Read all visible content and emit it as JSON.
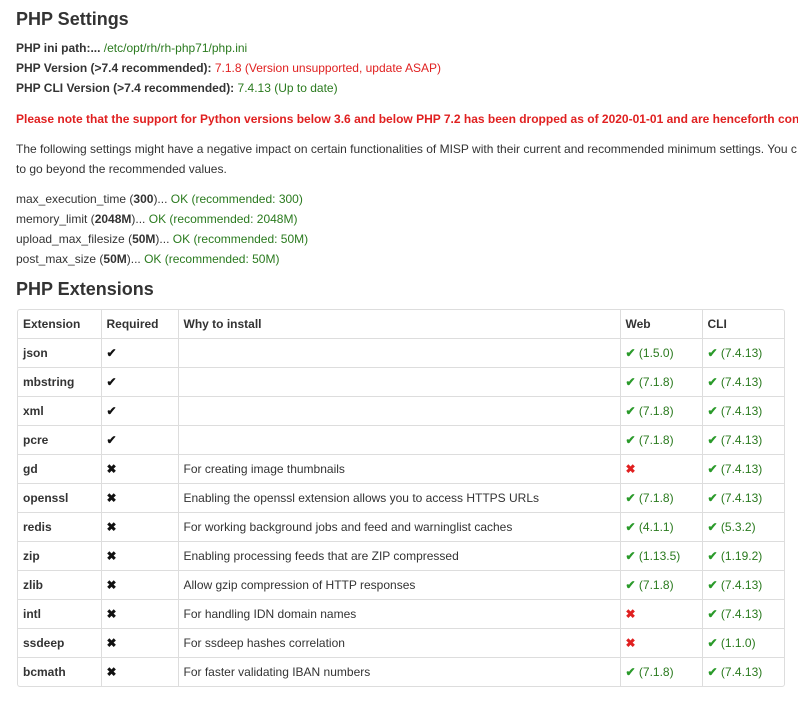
{
  "php_settings": {
    "title": "PHP Settings",
    "ini_label": "PHP ini path:...",
    "ini_value": "/etc/opt/rh/rh-php71/php.ini",
    "version_label": "PHP Version (>7.4 recommended):",
    "version_value": "7.1.8 (Version unsupported, update ASAP)",
    "cli_label": "PHP CLI Version (>7.4 recommended):",
    "cli_value": "7.4.13 (Up to date)",
    "warning": "Please note that the support for Python versions below 3.6 and below PHP 7.2 has been dropped as of 2020-01-01 and are henceforth con",
    "desc_line1": "The following settings might have a negative impact on certain functionalities of MISP with their current and recommended minimum settings. You c",
    "desc_line2": "to go beyond the recommended values.",
    "settings": [
      {
        "name": "max_execution_time",
        "value": "300",
        "status": "OK (recommended: 300)"
      },
      {
        "name": "memory_limit",
        "value": "2048M",
        "status": "OK (recommended: 2048M)"
      },
      {
        "name": "upload_max_filesize",
        "value": "50M",
        "status": "OK (recommended: 50M)"
      },
      {
        "name": "post_max_size",
        "value": "50M",
        "status": "OK (recommended: 50M)"
      }
    ]
  },
  "php_extensions": {
    "title": "PHP Extensions",
    "headers": [
      "Extension",
      "Required",
      "Why to install",
      "Web",
      "CLI"
    ],
    "rows": [
      {
        "name": "json",
        "required": "✔",
        "why": "",
        "web_ok": true,
        "web": "(1.5.0)",
        "cli_ok": true,
        "cli": "(7.4.13)"
      },
      {
        "name": "mbstring",
        "required": "✔",
        "why": "",
        "web_ok": true,
        "web": "(7.1.8)",
        "cli_ok": true,
        "cli": "(7.4.13)"
      },
      {
        "name": "xml",
        "required": "✔",
        "why": "",
        "web_ok": true,
        "web": "(7.1.8)",
        "cli_ok": true,
        "cli": "(7.4.13)"
      },
      {
        "name": "pcre",
        "required": "✔",
        "why": "",
        "web_ok": true,
        "web": "(7.1.8)",
        "cli_ok": true,
        "cli": "(7.4.13)"
      },
      {
        "name": "gd",
        "required": "✖",
        "why": "For creating image thumbnails",
        "web_ok": false,
        "web": "",
        "cli_ok": true,
        "cli": "(7.4.13)"
      },
      {
        "name": "openssl",
        "required": "✖",
        "why": "Enabling the openssl extension allows you to access HTTPS URLs",
        "web_ok": true,
        "web": "(7.1.8)",
        "cli_ok": true,
        "cli": "(7.4.13)"
      },
      {
        "name": "redis",
        "required": "✖",
        "why": "For working background jobs and feed and warninglist caches",
        "web_ok": true,
        "web": "(4.1.1)",
        "cli_ok": true,
        "cli": "(5.3.2)"
      },
      {
        "name": "zip",
        "required": "✖",
        "why": "Enabling processing feeds that are ZIP compressed",
        "web_ok": true,
        "web": "(1.13.5)",
        "cli_ok": true,
        "cli": "(1.19.2)"
      },
      {
        "name": "zlib",
        "required": "✖",
        "why": "Allow gzip compression of HTTP responses",
        "web_ok": true,
        "web": "(7.1.8)",
        "cli_ok": true,
        "cli": "(7.4.13)"
      },
      {
        "name": "intl",
        "required": "✖",
        "why": "For handling IDN domain names",
        "web_ok": false,
        "web": "",
        "cli_ok": true,
        "cli": "(7.4.13)"
      },
      {
        "name": "ssdeep",
        "required": "✖",
        "why": "For ssdeep hashes correlation",
        "web_ok": false,
        "web": "",
        "cli_ok": true,
        "cli": "(1.1.0)"
      },
      {
        "name": "bcmath",
        "required": "✖",
        "why": "For faster validating IBAN numbers",
        "web_ok": true,
        "web": "(7.1.8)",
        "cli_ok": true,
        "cli": "(7.4.13)"
      }
    ]
  }
}
